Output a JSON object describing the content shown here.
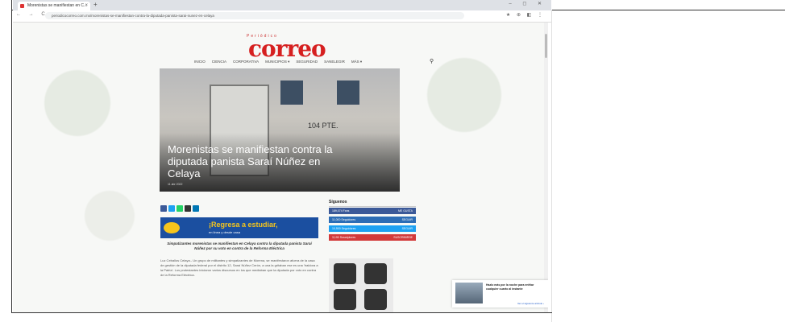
{
  "browser": {
    "tab_title": "Morenistas se manifiestan en C...",
    "new_tab": "+",
    "window_controls": "– ◻ ✕",
    "nav": "← → C",
    "url": "periodicocorreo.com.mx/morenistas-se-manifiestan-contra-la-diputada-panista-sarai-nunez-en-celaya",
    "extensions": "★ ⊕ ◧ ⋮"
  },
  "site": {
    "kicker": "Periódico",
    "brand": "correo",
    "menu": [
      "INICIO",
      "CIENCIA",
      "CORPORATIVA",
      "MUNICIPIOS ▾",
      "SEGURIDAD",
      "SANELEGIR",
      "MÁS ▾"
    ],
    "search_icon": "search-icon"
  },
  "article": {
    "headline": "Morenistas se manifiestan contra la diputada panista Saraí Núñez en Celaya",
    "date": "11 abr 2022",
    "house_number": "104 PTE.",
    "share_colors": [
      "#3b5998",
      "#1da1f2",
      "#25d366",
      "#333333",
      "#0077b5"
    ],
    "banner_title": "¡Regresa a estudiar,",
    "banner_sub": "en línea y desde casa",
    "caption": "Simpatizantes morenistas se manifiestan en Celaya contra la diputada panista Saraí Núñez por su voto en contra de la Reforma Eléctrica",
    "body": "Luz Ceballos  Celaya.- Un grupo de militantes y simpatizantes de Morena, se manifestaron afuera de la casa de gestión de la diputada federal por el distrito 12, Saraí Núñez Cerón, a una la gritaban ese es una 'traidora a la Patria'. Los protestantes iniciaron varios discursos en los que mediaban que la diputada por voto en contra de la Reforma Eléctrica."
  },
  "sidebar": {
    "heading": "Síguenos",
    "social": [
      {
        "label": "189,074 Fans",
        "count": "ME GUSTA",
        "color": "#3b5998"
      },
      {
        "label": "11,000 Seguidores",
        "count": "SEGUIR",
        "color": "#2d6db5"
      },
      {
        "label": "10,500 Seguidores",
        "count": "SEGUIR",
        "color": "#1da1f2"
      },
      {
        "label": "3,190 Suscriptores",
        "count": "SUSCRIBIRSE",
        "color": "#d33a3a"
      }
    ]
  },
  "notification": {
    "text": "Hazlo más por la noche para enfriar cualquier cuarto al instante",
    "link": "Ver el siguiente artículo ›"
  }
}
